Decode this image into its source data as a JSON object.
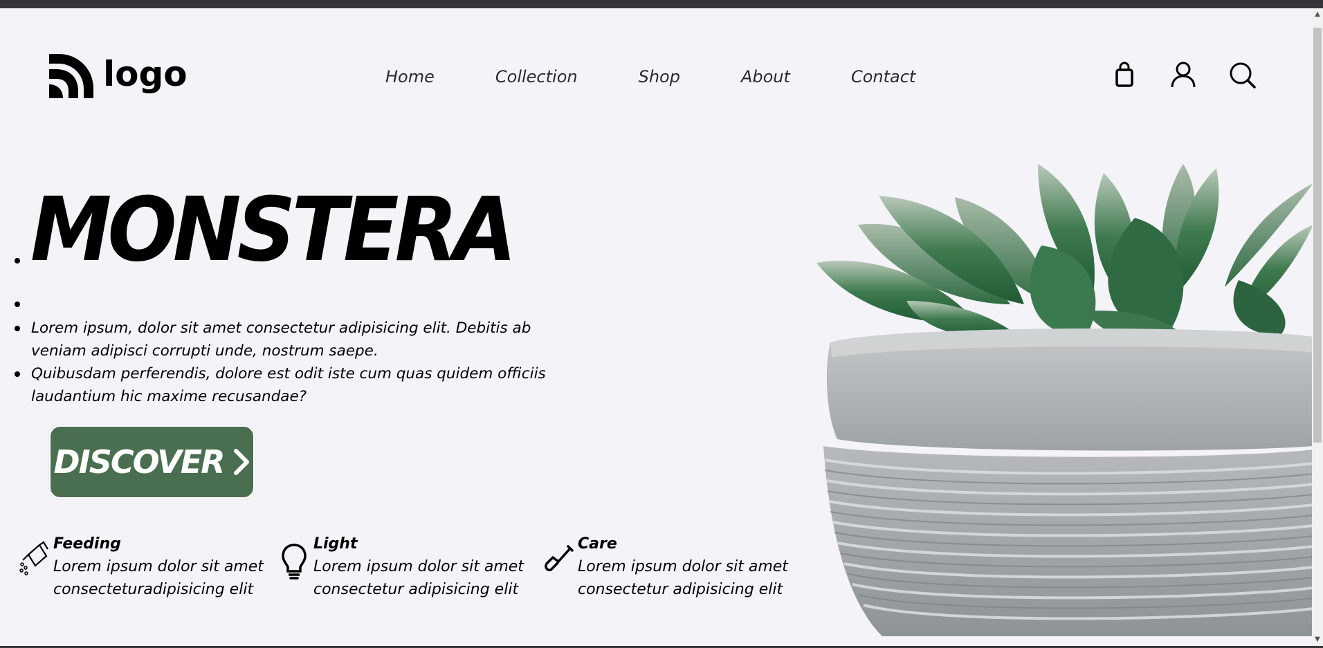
{
  "header": {
    "logo_text": "logo",
    "nav": [
      "Home",
      "Collection",
      "Shop",
      "About",
      "Contact"
    ],
    "icons": [
      "shopping-bag-icon",
      "user-icon",
      "search-icon"
    ]
  },
  "hero": {
    "title": "MONSTERA",
    "paragraph1": "Lorem ipsum, dolor sit amet consectetur adipisicing elit. Debitis ab veniam adipisci corrupti unde, nostrum saepe.",
    "paragraph2": "Quibusdam perferendis, dolore est odit iste cum quas quidem officiis laudantium hic maxime recusandae?",
    "button_label": "DISCOVER"
  },
  "features": [
    {
      "icon": "watering-can-icon",
      "title": "Feeding",
      "line1": "Lorem ipsum dolor sit amet",
      "line2": "consecteturadipisicing elit"
    },
    {
      "icon": "lightbulb-icon",
      "title": "Light",
      "line1": "Lorem ipsum dolor sit amet",
      "line2": "consectetur adipisicing elit"
    },
    {
      "icon": "shovel-icon",
      "title": "Care",
      "line1": "Lorem ipsum dolor sit amet",
      "line2": "consectetur adipisicing elit"
    }
  ],
  "colors": {
    "accent": "#4a6e50",
    "background": "#f3f3f8",
    "text": "#000000"
  }
}
